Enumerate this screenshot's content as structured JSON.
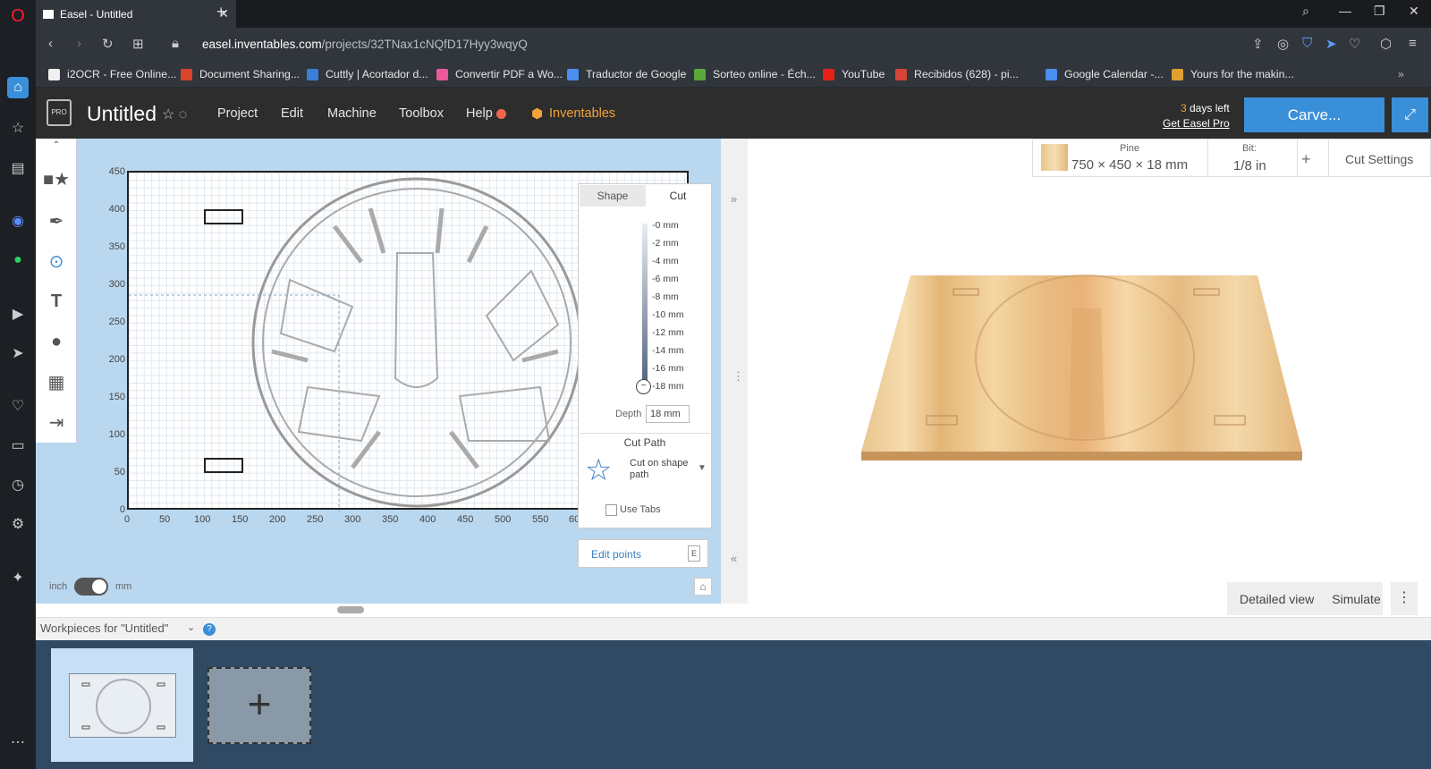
{
  "browser": {
    "tab_title": "Easel - Untitled",
    "url_host": "easel.inventables.com",
    "url_path": "/projects/32TNax1cNQfD17Hyy3wqyQ",
    "bookmarks": [
      {
        "label": "i2OCR - Free Online...",
        "color": "#f0f0f0"
      },
      {
        "label": "Document Sharing...",
        "color": "#d8442c"
      },
      {
        "label": "Cuttly | Acortador d...",
        "color": "#3a7fd8"
      },
      {
        "label": "Convertir PDF a Wo...",
        "color": "#e85a9a"
      },
      {
        "label": "Traductor de Google",
        "color": "#4a8ef0"
      },
      {
        "label": "Sorteo online - Éch...",
        "color": "#5aa83a"
      },
      {
        "label": "YouTube",
        "color": "#e62117"
      },
      {
        "label": "Recibidos (628) - pi...",
        "color": "#d44638"
      },
      {
        "label": "Google Calendar -...",
        "color": "#4a8ef0"
      },
      {
        "label": "Yours for the makin...",
        "color": "#e0a030"
      }
    ]
  },
  "app": {
    "project_title": "Untitled",
    "menu": [
      "Project",
      "Edit",
      "Machine",
      "Toolbox",
      "Help"
    ],
    "brand": "Inventables",
    "trial_days": "3",
    "trial_suffix": " days left",
    "trial_link": "Get Easel Pro",
    "carve_label": "Carve...",
    "accent": "#3a8fd9"
  },
  "canvas": {
    "y_ticks": [
      "450",
      "400",
      "350",
      "300",
      "250",
      "200",
      "150",
      "100",
      "50",
      "0"
    ],
    "x_ticks": [
      "0",
      "50",
      "100",
      "150",
      "200",
      "250",
      "300",
      "350",
      "400",
      "450",
      "500",
      "550",
      "60"
    ],
    "unit_left": "inch",
    "unit_right": "mm"
  },
  "cut_panel": {
    "tab_shape": "Shape",
    "tab_cut": "Cut",
    "depth_marks": [
      "-0 mm",
      "-2 mm",
      "-4 mm",
      "-6 mm",
      "-8 mm",
      "-10 mm",
      "-12 mm",
      "-14 mm",
      "-16 mm",
      "-18 mm"
    ],
    "depth_label": "Depth",
    "depth_value": "18 mm",
    "cut_path_heading": "Cut Path",
    "cut_path_option": "Cut on shape path",
    "use_tabs": "Use Tabs",
    "edit_points": "Edit points",
    "edit_points_key": "E"
  },
  "material": {
    "name": "Pine",
    "size": "750 × 450 × 18 mm",
    "bit_label": "Bit:",
    "bit_value": "1/8 in",
    "cut_settings": "Cut Settings"
  },
  "preview": {
    "detailed_view": "Detailed view",
    "simulate": "Simulate"
  },
  "workpieces": {
    "title": "Workpieces for \"Untitled\""
  }
}
